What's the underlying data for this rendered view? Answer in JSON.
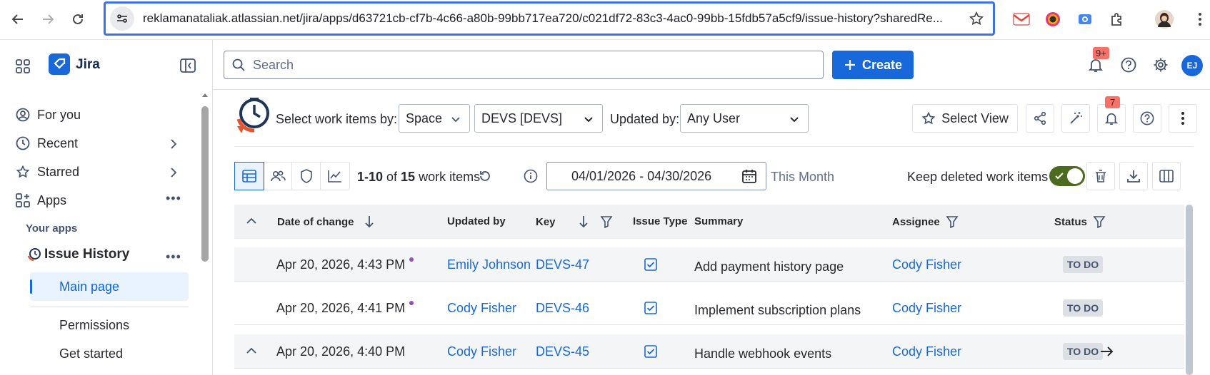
{
  "browser": {
    "url": "reklamanataliak.atlassian.net/jira/apps/d63721cb-cf7b-4c66-a80b-99bb717ea720/c021df72-83c3-4ac0-99bb-15fdb57a5cf9/issue-history?sharedRe..."
  },
  "sidebar": {
    "product": "Jira",
    "items": [
      {
        "label": "For you"
      },
      {
        "label": "Recent"
      },
      {
        "label": "Starred"
      },
      {
        "label": "Apps"
      }
    ],
    "your_apps_heading": "Your apps",
    "app_name": "Issue History",
    "main_page": "Main page",
    "sub_items": [
      {
        "label": "Permissions"
      },
      {
        "label": "Get started"
      }
    ]
  },
  "topnav": {
    "search_placeholder": "Search",
    "create_label": "Create",
    "notifications_badge": "9+",
    "avatar_initials": "EJ"
  },
  "toolbar": {
    "select_by_label": "Select work items by:",
    "select_by_value": "Space",
    "space_value": "DEVS [DEVS]",
    "updated_by_label": "Updated by:",
    "updated_by_value": "Any User",
    "select_view_label": "Select View",
    "alerts_badge": "7"
  },
  "filters": {
    "range_start": "1-10",
    "total": "15",
    "unit": "work items",
    "date_range": "04/01/2026 - 04/30/2026",
    "preset": "This Month",
    "keep_deleted_label": "Keep deleted work items",
    "keep_deleted_on": true
  },
  "table": {
    "columns": {
      "date": "Date of change",
      "updated_by": "Updated by",
      "key": "Key",
      "issue_type": "Issue Type",
      "summary": "Summary",
      "assignee": "Assignee",
      "status": "Status"
    },
    "rows": [
      {
        "date": "Apr 20, 2026, 4:43 PM",
        "updated_by": "Emily Johnson",
        "key": "DEVS-47",
        "summary": "Add payment history page",
        "assignee": "Cody Fisher",
        "status": "TO DO"
      },
      {
        "date": "Apr 20, 2026, 4:41 PM",
        "updated_by": "Cody Fisher",
        "key": "DEVS-46",
        "summary": "Implement subscription plans",
        "assignee": "Cody Fisher",
        "status": "TO DO"
      },
      {
        "date": "Apr 20, 2026, 4:40 PM",
        "updated_by": "Cody Fisher",
        "key": "DEVS-45",
        "summary": "Handle webhook events",
        "assignee": "Cody Fisher",
        "status": "TO DO"
      }
    ]
  },
  "colors": {
    "accent": "#1868db",
    "toggle_on": "#4c6b1f",
    "badge": "#f87168",
    "url_focus": "#3b73e6"
  }
}
